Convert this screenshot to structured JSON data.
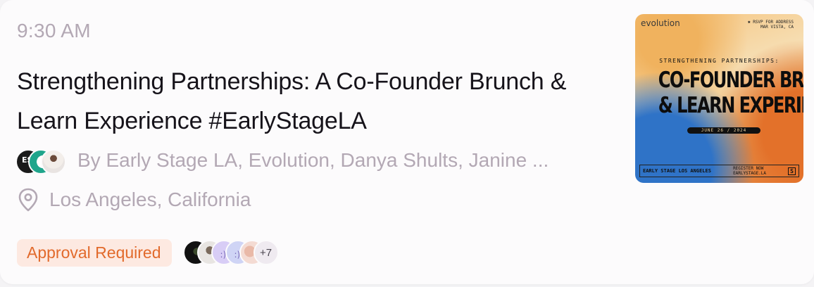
{
  "event": {
    "time": "9:30 AM",
    "title": "Strengthening Partnerships: A Co-Founder Brunch & Learn Experience #EarlyStageLA",
    "hosts_text": "By Early Stage LA, Evolution, Danya Shults, Janine ...",
    "location": "Los Angeles, California",
    "approval_badge": "Approval Required",
    "guest_more": "+7"
  },
  "cover": {
    "brand": "evolution",
    "rsvp": "✱ RSVP FOR ADDRESS\nMAR VISTA, CA",
    "subtitle": "STRENGTHENING PARTNERSHIPS:",
    "headline_1": "CO-FOUNDER BRUNCH",
    "headline_2": "& LEARN EXPERIENCE",
    "date": "JUNE 26 / 2024",
    "footer_left": "EARLY STAGE LOS ANGELES",
    "footer_mid": "REGISTER NOW\nEARLYSTAGE.LA",
    "footer_right": "S"
  },
  "icons": {
    "location": "map-pin-icon"
  },
  "colors": {
    "muted_text": "#b3a8b4",
    "title_text": "#16131a",
    "badge_bg": "#fde9e1",
    "badge_text": "#e26a2c"
  }
}
